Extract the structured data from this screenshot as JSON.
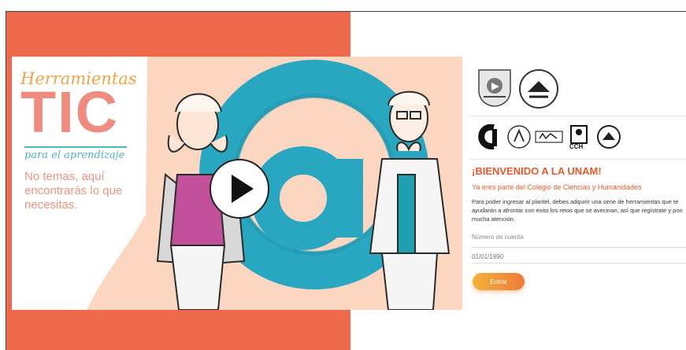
{
  "video": {
    "title_top": "Herramientas",
    "title_main": "TIC",
    "title_sub": "para el aprendizaje",
    "tagline": "No temas, aquí encontrarás lo que necesitas.",
    "play_icon": "play-icon",
    "colors": {
      "orange_bg": "#ef6a4a",
      "peach": "#fbd6c0",
      "teal": "#2aa7c0",
      "salmon": "#ef8c7f"
    }
  },
  "logos": {
    "top": [
      "unam-seal",
      "cch-seal"
    ],
    "row": [
      "cch-logo",
      "azcapotzalco-seal",
      "vallejo-logo",
      "cch-icon-logo",
      "round-seal"
    ],
    "cch_text": "CCH"
  },
  "welcome": {
    "title": "¡BIENVENIDO A LA UNAM!",
    "subtitle": "Ya eres parte del Colegio de Ciencias y Humanidades",
    "instructions": "Para poder ingresar al plantel, debes adquirir una serie de herramientas que te ayudarán a afrontar con éxito los retos que se avecinan, así que regístrate y pon mucha atención."
  },
  "form": {
    "account_label": "Número de cuenta",
    "date_placeholder": "01/01/1990",
    "submit_label": "Entrar"
  }
}
